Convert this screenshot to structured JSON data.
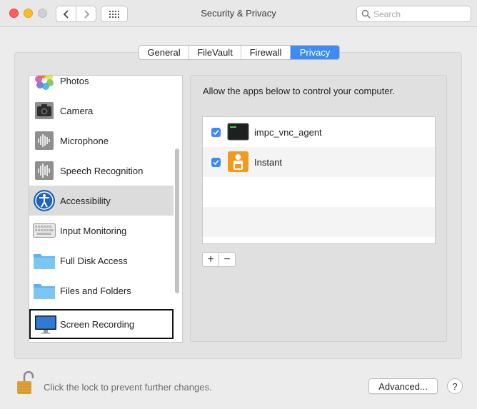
{
  "window": {
    "title": "Security & Privacy",
    "search_placeholder": "Search"
  },
  "tabs": [
    {
      "label": "General",
      "active": false
    },
    {
      "label": "FileVault",
      "active": false
    },
    {
      "label": "Firewall",
      "active": false
    },
    {
      "label": "Privacy",
      "active": true
    }
  ],
  "sidebar": {
    "items": [
      {
        "label": "Photos",
        "icon": "photos-icon"
      },
      {
        "label": "Camera",
        "icon": "camera-icon"
      },
      {
        "label": "Microphone",
        "icon": "microphone-icon"
      },
      {
        "label": "Speech Recognition",
        "icon": "speech-recognition-icon"
      },
      {
        "label": "Accessibility",
        "icon": "accessibility-icon",
        "selected": true
      },
      {
        "label": "Input Monitoring",
        "icon": "keyboard-icon"
      },
      {
        "label": "Full Disk Access",
        "icon": "folder-icon"
      },
      {
        "label": "Files and Folders",
        "icon": "folder-icon"
      },
      {
        "label": "Screen Recording",
        "icon": "display-icon",
        "outlined": true
      }
    ]
  },
  "main": {
    "instruction": "Allow the apps below to control your computer.",
    "apps": [
      {
        "name": "impc_vnc_agent",
        "checked": true,
        "icon": "terminal-icon"
      },
      {
        "name": "Instant",
        "checked": true,
        "icon": "instant-app-icon"
      }
    ],
    "add_label": "+",
    "remove_label": "−"
  },
  "footer": {
    "lock_message": "Click the lock to prevent further changes.",
    "advanced_label": "Advanced...",
    "help_label": "?"
  },
  "colors": {
    "accent": "#3c8cf7",
    "selected_row": "#dcdcdc"
  }
}
